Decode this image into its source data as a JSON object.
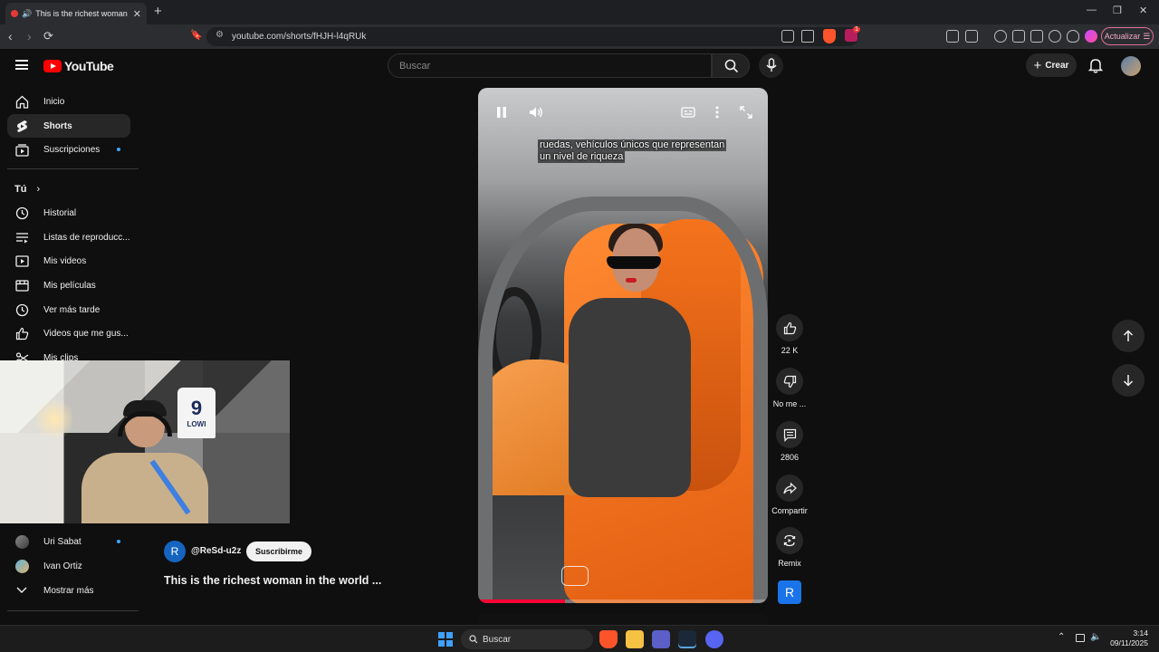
{
  "browser": {
    "tab_title": "This is the richest woman in th",
    "url": "youtube.com/shorts/fHJH-l4qRUk",
    "update_label": "Actualizar",
    "shield_badge": "1"
  },
  "header": {
    "logo_text": "YouTube",
    "search_placeholder": "Buscar",
    "create_label": "Crear"
  },
  "sidebar": {
    "top_items": [
      {
        "label": "Inicio",
        "icon": "home-icon"
      },
      {
        "label": "Shorts",
        "icon": "shorts-icon"
      },
      {
        "label": "Suscripciones",
        "icon": "subscriptions-icon"
      }
    ],
    "you_label": "Tú",
    "you_items": [
      {
        "label": "Historial",
        "icon": "history-icon"
      },
      {
        "label": "Listas de reproducc...",
        "icon": "playlist-icon"
      },
      {
        "label": "Mis videos",
        "icon": "my-videos-icon"
      },
      {
        "label": "Mis películas",
        "icon": "movies-icon"
      },
      {
        "label": "Ver más tarde",
        "icon": "watch-later-icon"
      },
      {
        "label": "Videos que me gus...",
        "icon": "liked-icon"
      },
      {
        "label": "Mis clips",
        "icon": "clips-icon"
      }
    ],
    "subscriptions": [
      {
        "label": "Uri Sabat"
      },
      {
        "label": "Ivan Ortiz"
      }
    ],
    "show_more": "Mostrar más"
  },
  "video": {
    "caption_line1": "ruedas, vehículos únicos que representan",
    "caption_line2": "un nivel de riqueza",
    "progress_fraction": 0.3,
    "channel_initial": "R",
    "channel_name": "@ReSd-u2z",
    "subscribe_label": "Suscribirme",
    "title": "This is the richest woman in the world ..."
  },
  "actions": {
    "likes": "22 K",
    "dislike_label": "No me ...",
    "comments": "2806",
    "share_label": "Compartir",
    "remix_label": "Remix",
    "remix_badge": "R"
  },
  "taskbar": {
    "search_label": "Buscar",
    "time": "3:14",
    "date": "09/11/2025"
  },
  "colors": {
    "accent_red": "#ff0000",
    "progress_red": "#ff0033",
    "link_blue": "#3ea6ff"
  }
}
